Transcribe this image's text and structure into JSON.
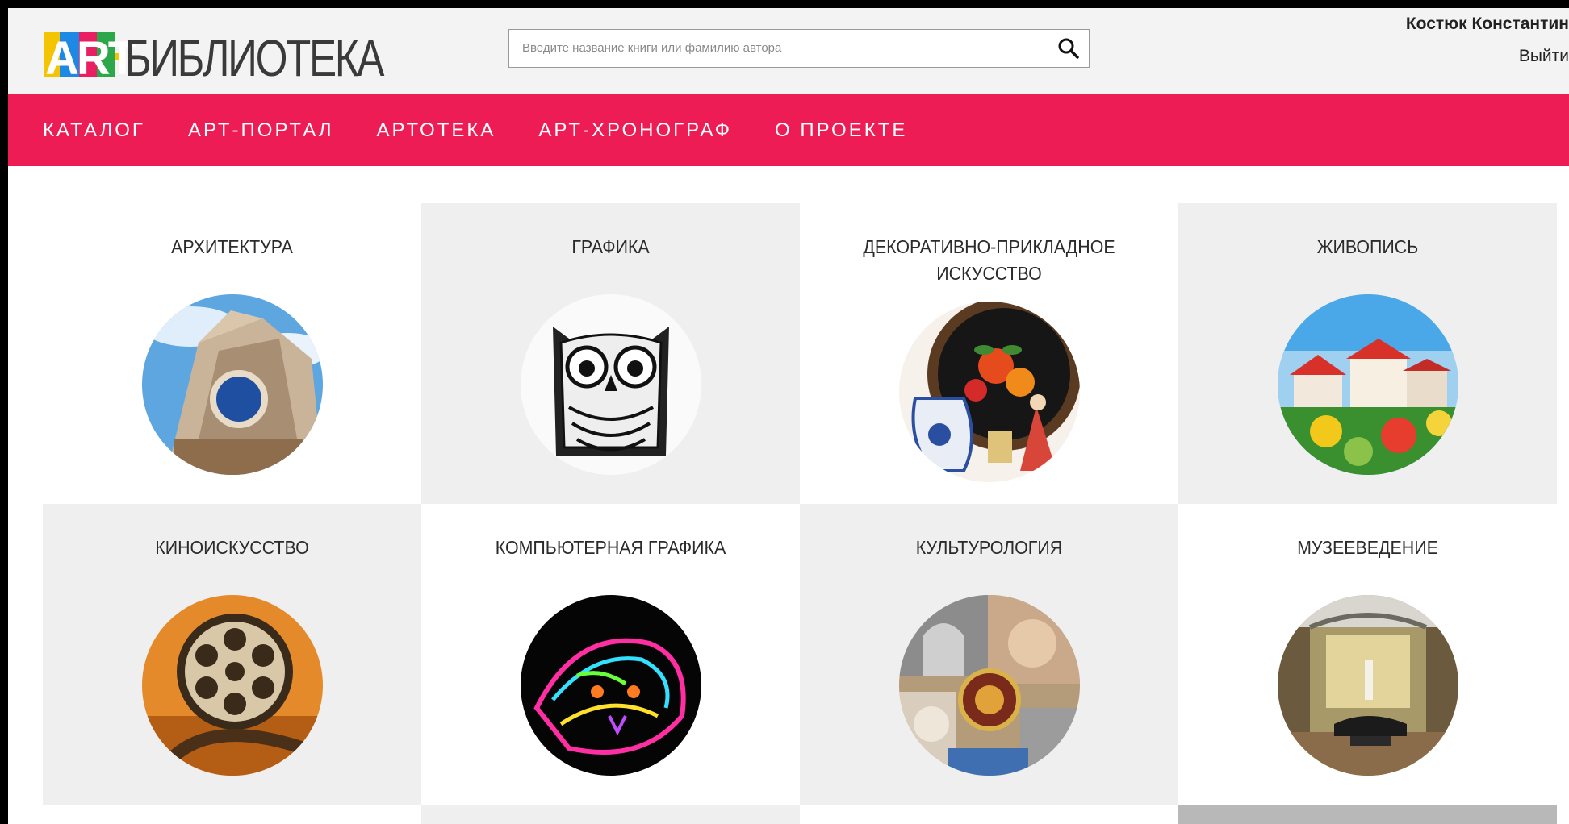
{
  "logo": {
    "art": "ART",
    "library": "-БИБЛИОТЕКА"
  },
  "search": {
    "placeholder": "Введите название книги или фамилию автора"
  },
  "user": {
    "name": "Костюк Константин",
    "logout": "Выйти"
  },
  "nav": [
    "КАТАЛОГ",
    "АРТ-ПОРТАЛ",
    "АРТОТЕКА",
    "АРТ-ХРОНОГРАФ",
    "О ПРОЕКТЕ"
  ],
  "categories": [
    {
      "title": "АРХИТЕКТУРА",
      "image": "cathedral-facade"
    },
    {
      "title": "ГРАФИКА",
      "image": "owl-ink-drawing"
    },
    {
      "title": "ДЕКОРАТИВНО-ПРИКЛАДНОЕ ИСКУССТВО",
      "image": "painted-tray-and-pottery"
    },
    {
      "title": "ЖИВОПИСЬ",
      "image": "village-painting"
    },
    {
      "title": "КИНОИСКУССТВО",
      "image": "film-reel"
    },
    {
      "title": "КОМПЬЮТЕРНАЯ ГРАФИКА",
      "image": "neon-leopard"
    },
    {
      "title": "КУЛЬТУРОЛОГИЯ",
      "image": "art-collage"
    },
    {
      "title": "МУЗЕЕВЕДЕНИЕ",
      "image": "museum-hall"
    }
  ],
  "colors": {
    "accent": "#ed1c55",
    "header_bg": "#f3f3f3",
    "tile_grey": "#efefef"
  }
}
